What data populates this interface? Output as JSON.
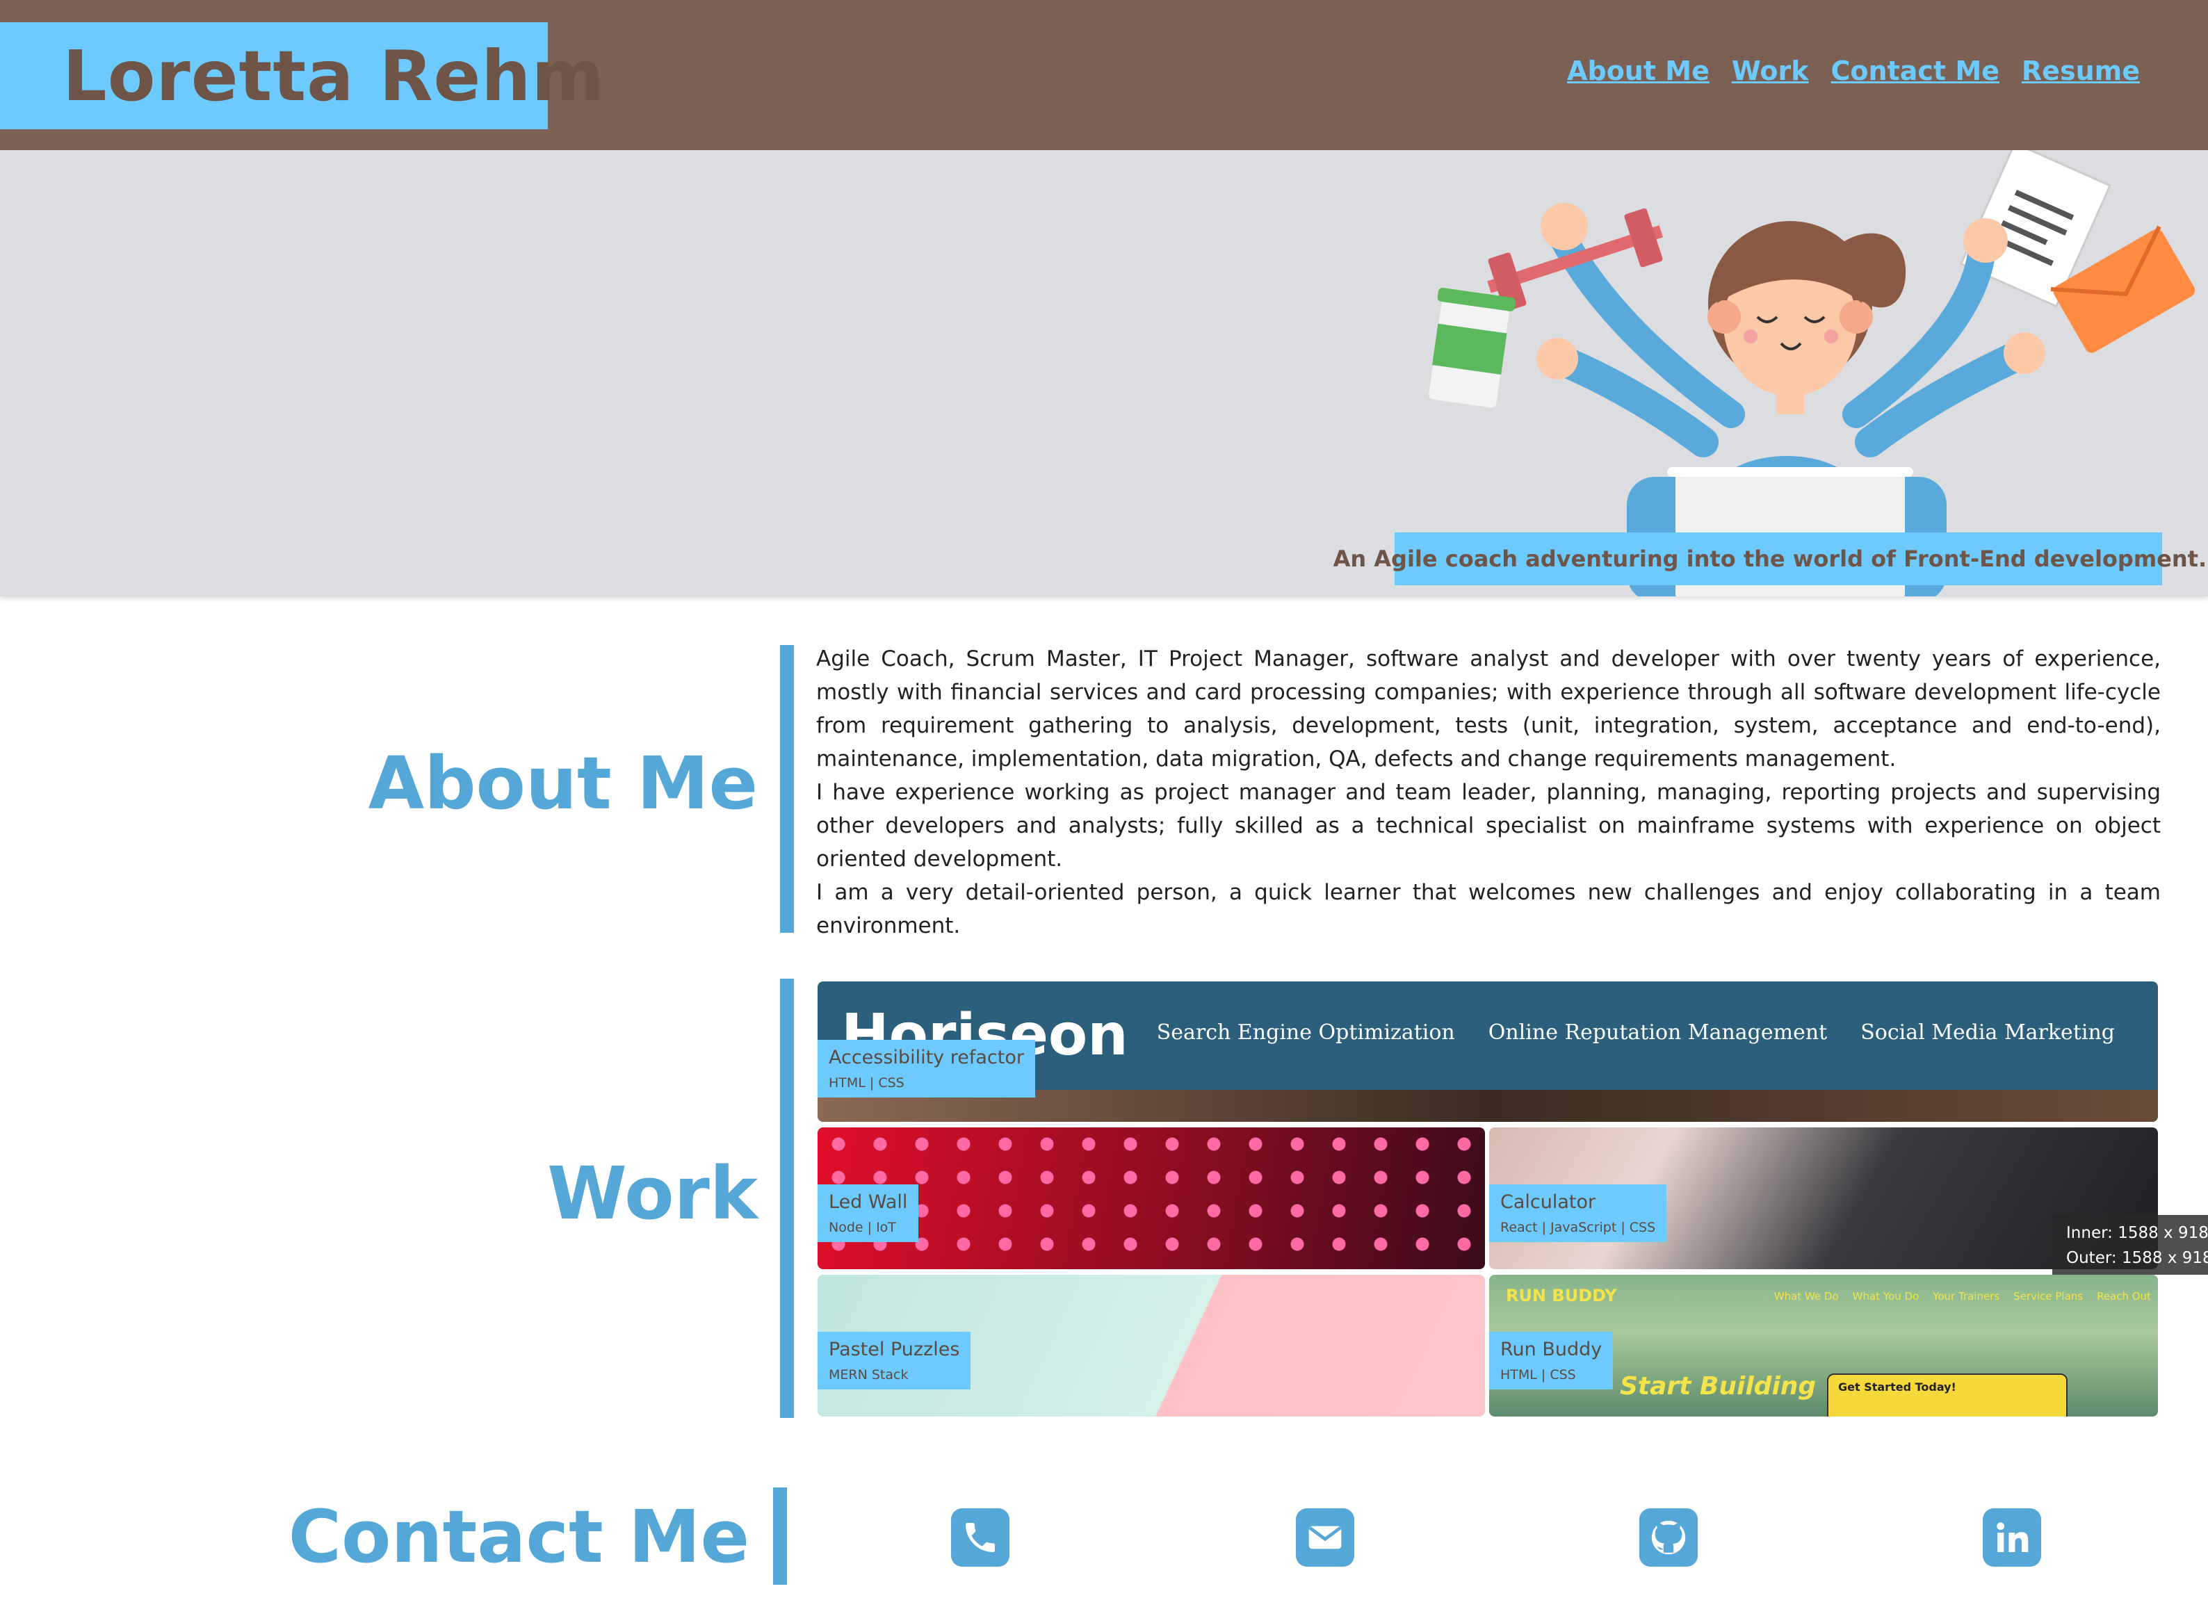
{
  "header": {
    "name": "Loretta Rehm",
    "nav": [
      "About Me",
      "Work",
      "Contact Me",
      "Resume"
    ]
  },
  "hero": {
    "tagline": "An Agile coach adventuring into the world of Front-End development..."
  },
  "about": {
    "title": "About Me",
    "paragraphs": [
      "Agile Coach, Scrum Master, IT Project Manager, software analyst and developer with over twenty years of experience, mostly with financial services and card processing companies; with experience through all software development life-cycle from requirement gathering to analysis, development, tests (unit, integration, system, acceptance and end-to-end), maintenance, implementation, data migration, QA, defects and change requirements management.",
      "I have experience working as project manager and team leader, planning, managing, reporting projects and supervising other developers and analysts; fully skilled as a technical specialist on mainframe systems with experience on object oriented development.",
      "I am a very detail-oriented person, a quick learner that welcomes new challenges and enjoy collaborating in a team environment."
    ]
  },
  "work": {
    "title": "Work",
    "projects": [
      {
        "title": "Accessibility refactor",
        "tech": "HTML | CSS"
      },
      {
        "title": "Led Wall",
        "tech": "Node | IoT"
      },
      {
        "title": "Calculator",
        "tech": "React | JavaScript | CSS"
      },
      {
        "title": "Pastel Puzzles",
        "tech": "MERN Stack"
      },
      {
        "title": "Run Buddy",
        "tech": "HTML | CSS"
      }
    ],
    "horiseon": {
      "logo": "Horiseon",
      "nav": [
        "Search Engine Optimization",
        "Online Reputation Management",
        "Social Media Marketing"
      ]
    },
    "runbuddy": {
      "logo": "RUN BUDDY",
      "nav": [
        "What We Do",
        "What You Do",
        "Your Trainers",
        "Service Plans",
        "Reach Out"
      ],
      "hero": "Start Building",
      "form_title": "Get Started Today!"
    }
  },
  "devtools": {
    "inner": "Inner: 1588 x 918",
    "outer": "Outer: 1588 x 918"
  },
  "contact": {
    "title": "Contact Me",
    "icons": [
      "phone-icon",
      "email-icon",
      "github-icon",
      "linkedin-icon"
    ]
  },
  "colors": {
    "header_bg": "#7a6153",
    "accent": "#6ccaff",
    "section_blue": "#54a7d6",
    "hero_bg": "#dcdde0"
  }
}
